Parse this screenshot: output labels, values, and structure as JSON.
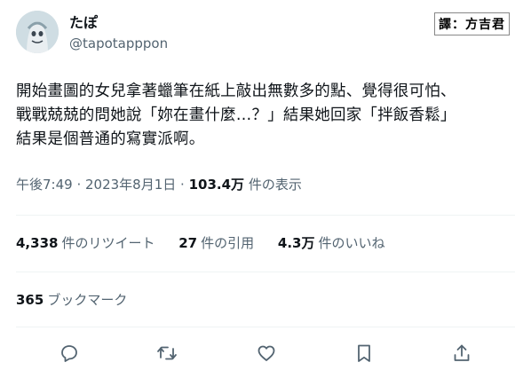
{
  "author": {
    "display_name": "たぽ",
    "handle": "@tapotapppon"
  },
  "watermark": "譯：方吉君",
  "tweet": {
    "text_lines": [
      "開始畫圖的女兒拿著蠟筆在紙上敲出無數多的點、覺得很可怕、",
      "戰戰兢兢的問她說「妳在畫什麼…？」結果她回家「拌飯香鬆」",
      "結果是個普通的寫實派啊。"
    ]
  },
  "meta": {
    "time": "午後7:49",
    "separator": " · ",
    "date": "2023年8月1日",
    "views_count": "103.4万",
    "views_label": "件の表示"
  },
  "stats": {
    "retweets_count": "4,338",
    "retweets_label": "件のリツイート",
    "quotes_count": "27",
    "quotes_label": "件の引用",
    "likes_count": "4.3万",
    "likes_label": "件のいいね"
  },
  "bookmarks": {
    "count": "365",
    "label": "ブックマーク"
  },
  "actions": [
    {
      "name": "reply-icon"
    },
    {
      "name": "retweet-icon"
    },
    {
      "name": "like-icon"
    },
    {
      "name": "bookmark-icon"
    },
    {
      "name": "share-icon"
    }
  ],
  "colors": {
    "text": "#0f1419",
    "secondary": "#536471",
    "divider": "#eff3f4"
  }
}
